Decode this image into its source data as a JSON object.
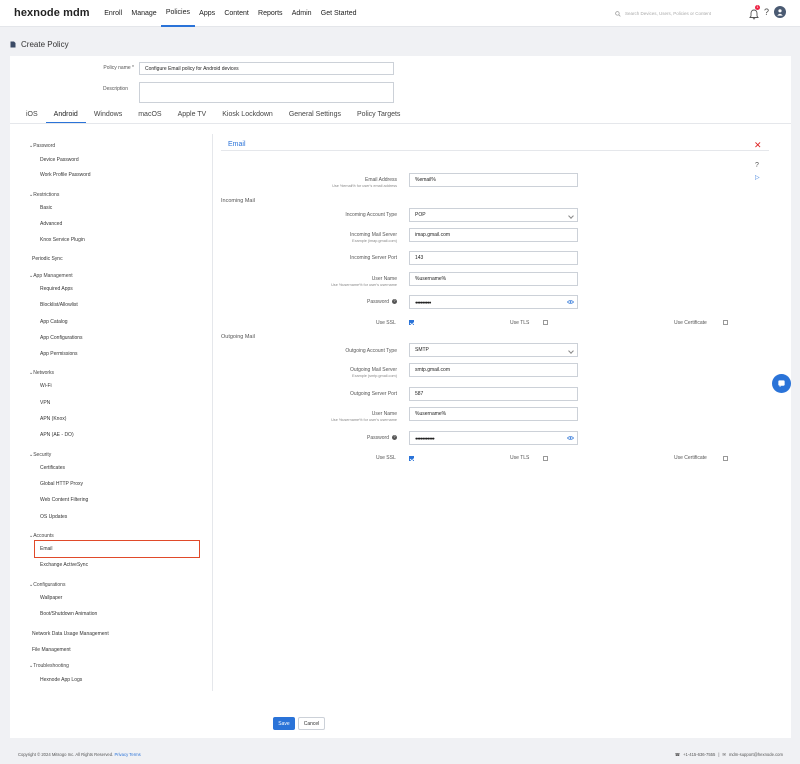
{
  "app": {
    "logo": "hexnode mdm"
  },
  "nav": [
    "Enroll",
    "Manage",
    "Policies",
    "Apps",
    "Content",
    "Reports",
    "Admin",
    "Get Started"
  ],
  "nav_active": "Policies",
  "search": {
    "placeholder": "Search Devices, Users, Policies or Content"
  },
  "notifications": {
    "count": "1"
  },
  "page": {
    "title": "Create Policy"
  },
  "policy": {
    "name_label": "Policy name *",
    "name_value": "Configure Email policy for Android devices",
    "description_label": "Description",
    "description_value": ""
  },
  "tabs": [
    "iOS",
    "Android",
    "Windows",
    "macOS",
    "Apple TV",
    "Kiosk Lockdown",
    "General Settings",
    "Policy Targets"
  ],
  "sidebar": {
    "password": "Password",
    "device_password": "Device Password",
    "work_profile_password": "Work Profile Password",
    "restrictions": "Restrictions",
    "basic": "Basic",
    "advanced": "Advanced",
    "knox_service_plugin": "Knox Service Plugin",
    "periodic_sync": "Periodic Sync",
    "app_management": "App Management",
    "required_apps": "Required Apps",
    "blocklist_allowlist": "Blocklist/Allowlist",
    "app_catalog": "App Catalog",
    "app_configurations": "App Configurations",
    "app_permissions": "App Permissions",
    "networks": "Networks",
    "wifi": "Wi-Fi",
    "vpn": "VPN",
    "apn_knox": "APN (Knox)",
    "apn_ae_do": "APN (AE - DO)",
    "security": "Security",
    "certificates": "Certificates",
    "global_http_proxy": "Global HTTP Proxy",
    "web_content_filtering": "Web Content Filtering",
    "os_updates": "OS Updates",
    "accounts": "Accounts",
    "email": "Email",
    "exchange_activesync": "Exchange ActiveSync",
    "configurations": "Configurations",
    "wallpaper": "Wallpaper",
    "boot_shutdown_animation": "Boot/Shutdown Animation",
    "network_data_usage_management": "Network Data Usage Management",
    "file_management": "File Management",
    "troubleshooting": "Troubleshooting",
    "hexnode_app_logs": "Hexnode App Logs"
  },
  "email": {
    "title": "Email",
    "address_label": "Email Address",
    "address_hint": "Use %email% for user's email address",
    "address_value": "%email%",
    "incoming_section": "Incoming Mail",
    "outgoing_section": "Outgoing Mail",
    "incoming": {
      "type_label": "Incoming Account Type",
      "type_value": "POP",
      "server_label": "Incoming Mail Server",
      "server_hint": "Example (imap.gmail.com)",
      "server_value": "imap.gmail.com",
      "port_label": "Incoming Server Port",
      "port_value": "143",
      "user_label": "User Name",
      "user_hint": "Use %username% for user's username",
      "user_value": "%username%",
      "password_label": "Password",
      "password_value": "●●●●●●●●●",
      "ssl_label": "Use SSL",
      "ssl": true,
      "tls_label": "Use TLS",
      "tls": false,
      "cert_label": "Use Certificate",
      "cert": false
    },
    "outgoing": {
      "type_label": "Outgoing Account Type",
      "type_value": "SMTP",
      "server_label": "Outgoing Mail Server",
      "server_hint": "Example (smtp.gmail.com)",
      "server_value": "smtp.gmail.com",
      "port_label": "Outgoing Server Port",
      "port_value": "587",
      "user_label": "User Name",
      "user_hint": "Use %username% for user's username",
      "user_value": "%username%",
      "password_label": "Password",
      "password_value": "●●●●●●●●●●●",
      "ssl_label": "Use SSL",
      "ssl": true,
      "tls_label": "Use TLS",
      "tls": false,
      "cert_label": "Use Certificate",
      "cert": false
    }
  },
  "buttons": {
    "save": "Save",
    "cancel": "Cancel"
  },
  "footer": {
    "copyright": "Copyright © 2024 Mitsogo Inc. All Rights Reserved.",
    "privacy": "Privacy",
    "terms": "Terms",
    "phone": "+1-415-636-7555",
    "separator": "|",
    "support_email": "mdm-support@hexnode.com"
  },
  "colors": {
    "accent": "#2a73d8",
    "selected_outline": "#e04a2a",
    "close": "#dd2222"
  }
}
